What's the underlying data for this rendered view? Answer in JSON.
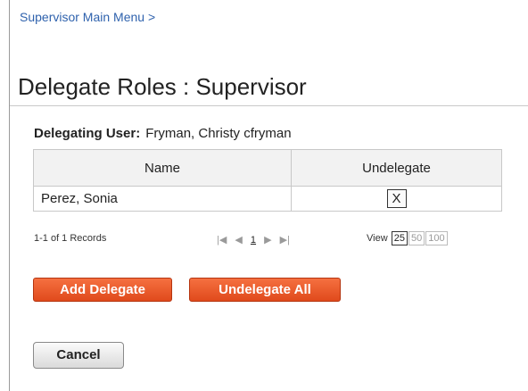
{
  "breadcrumb": "Supervisor Main Menu >",
  "page_title": "Delegate Roles : Supervisor",
  "delegating": {
    "label": "Delegating User:",
    "value": "Fryman, Christy cfryman"
  },
  "table": {
    "headers": {
      "name": "Name",
      "undelegate": "Undelegate"
    },
    "rows": [
      {
        "name": "Perez, Sonia",
        "action": "X"
      }
    ]
  },
  "pagination": {
    "records": "1-1 of 1 Records",
    "first_icon": "first-page-icon",
    "prev_icon": "prev-page-icon",
    "current_page": "1",
    "next_icon": "next-page-icon",
    "last_icon": "last-page-icon",
    "view_label": "View",
    "page_sizes": [
      "25",
      "50",
      "100"
    ],
    "selected_page_size": "25"
  },
  "buttons": {
    "add_delegate": "Add Delegate",
    "undelegate_all": "Undelegate All",
    "cancel": "Cancel"
  },
  "colors": {
    "link": "#2f62ad",
    "accent": "#e8552a"
  }
}
